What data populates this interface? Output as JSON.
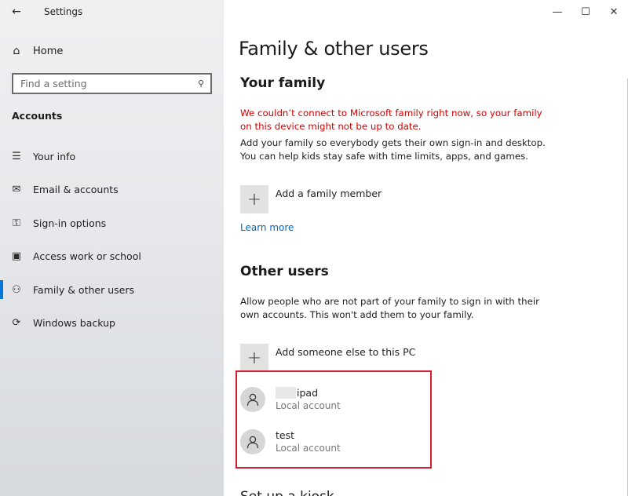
{
  "window": {
    "app_title": "Settings",
    "controls": {
      "minimize": "—",
      "maximize": "☐",
      "close": "✕"
    }
  },
  "sidebar": {
    "back_icon": "←",
    "home_label": "Home",
    "home_icon": "⌂",
    "search_placeholder": "Find a setting",
    "search_icon": "⚲",
    "section": "Accounts",
    "items": [
      {
        "label": "Your info",
        "icon": "person-card-icon",
        "glyph": "☰"
      },
      {
        "label": "Email & accounts",
        "icon": "mail-icon",
        "glyph": "✉"
      },
      {
        "label": "Sign-in options",
        "icon": "key-icon",
        "glyph": "⚿"
      },
      {
        "label": "Access work or school",
        "icon": "briefcase-icon",
        "glyph": "▣"
      },
      {
        "label": "Family & other users",
        "icon": "person-add-icon",
        "glyph": "⚇",
        "active": true
      },
      {
        "label": "Windows backup",
        "icon": "sync-icon",
        "glyph": "⟳"
      }
    ]
  },
  "main": {
    "title": "Family & other users",
    "your_family": {
      "heading": "Your family",
      "warning": "We couldn’t connect to Microsoft family right now, so your family on this device might not be up to date.",
      "description": "Add your family so everybody gets their own sign-in and desktop. You can help kids stay safe with time limits, apps, and games.",
      "add_label": "Add a family member",
      "learn_more": "Learn more"
    },
    "other_users": {
      "heading": "Other users",
      "description": "Allow people who are not part of your family to sign in with their own accounts. This won't add them to your family.",
      "add_label": "Add someone else to this PC",
      "users": [
        {
          "name": "ipad",
          "type": "Local account",
          "redacted_prefix": true
        },
        {
          "name": "test",
          "type": "Local account"
        }
      ]
    },
    "next_heading_cut": "Set up a kiosk"
  },
  "colors": {
    "accent": "#0078d7",
    "warning": "#d40000",
    "link": "#0067c0",
    "highlight_border": "#d4202c"
  }
}
